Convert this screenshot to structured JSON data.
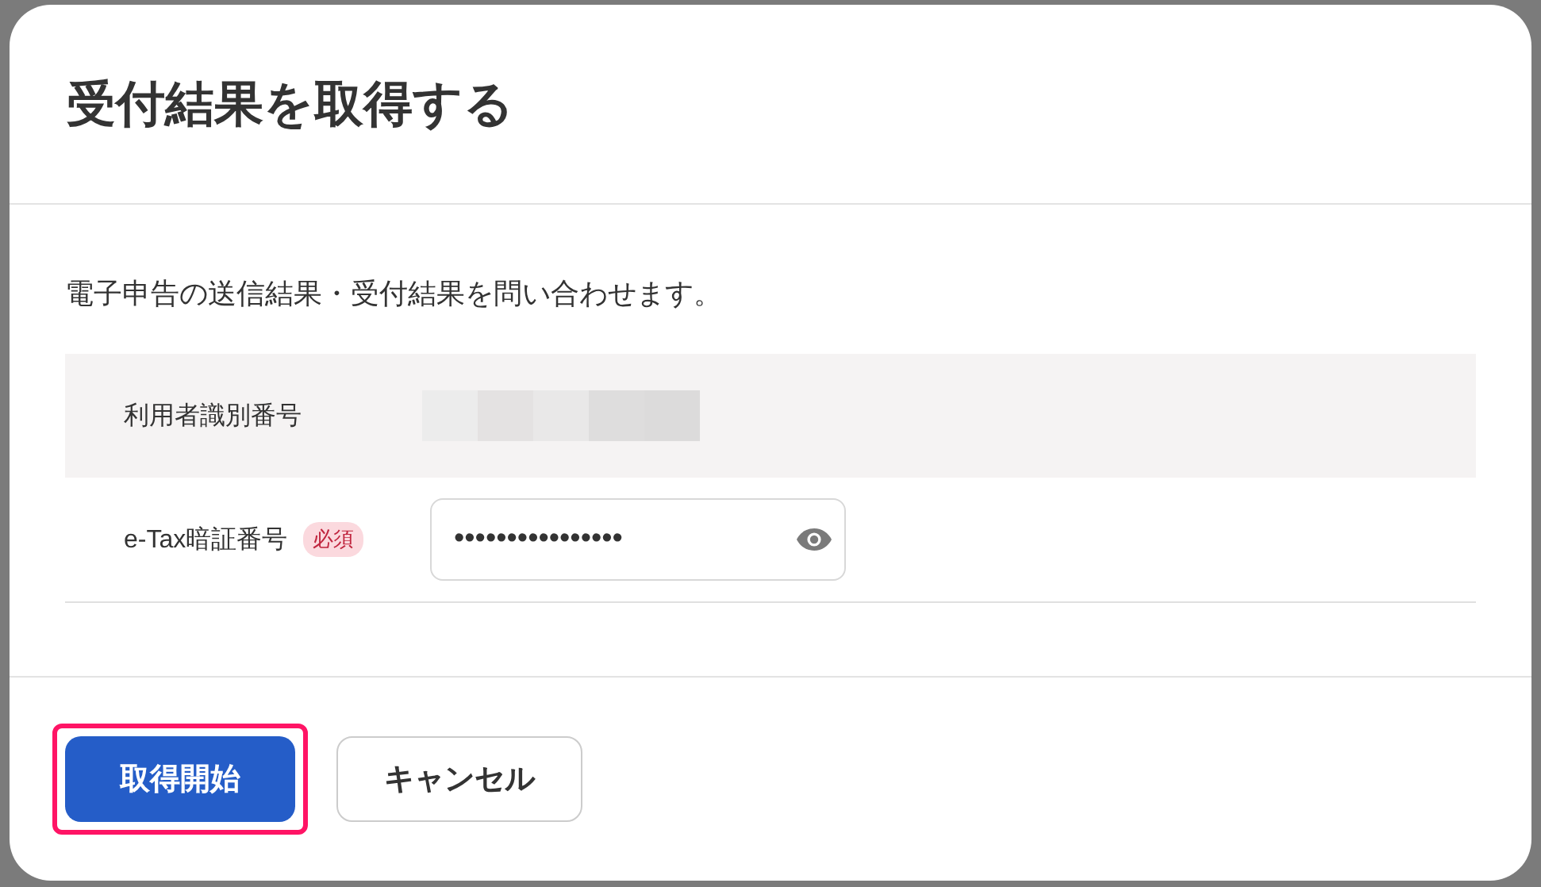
{
  "dialog": {
    "title": "受付結果を取得する",
    "description": "電子申告の送信結果・受付結果を問い合わせます。",
    "fields": [
      {
        "kind": "readonly",
        "label": "利用者識別番号"
      },
      {
        "kind": "password",
        "label": "e-Tax暗証番号",
        "badge": "必須",
        "value": "••••••••••••••••"
      }
    ],
    "buttons": [
      {
        "label": "取得開始",
        "kind": "primary",
        "highlighted": true
      },
      {
        "label": "キャンセル",
        "kind": "secondary",
        "highlighted": false
      }
    ]
  }
}
